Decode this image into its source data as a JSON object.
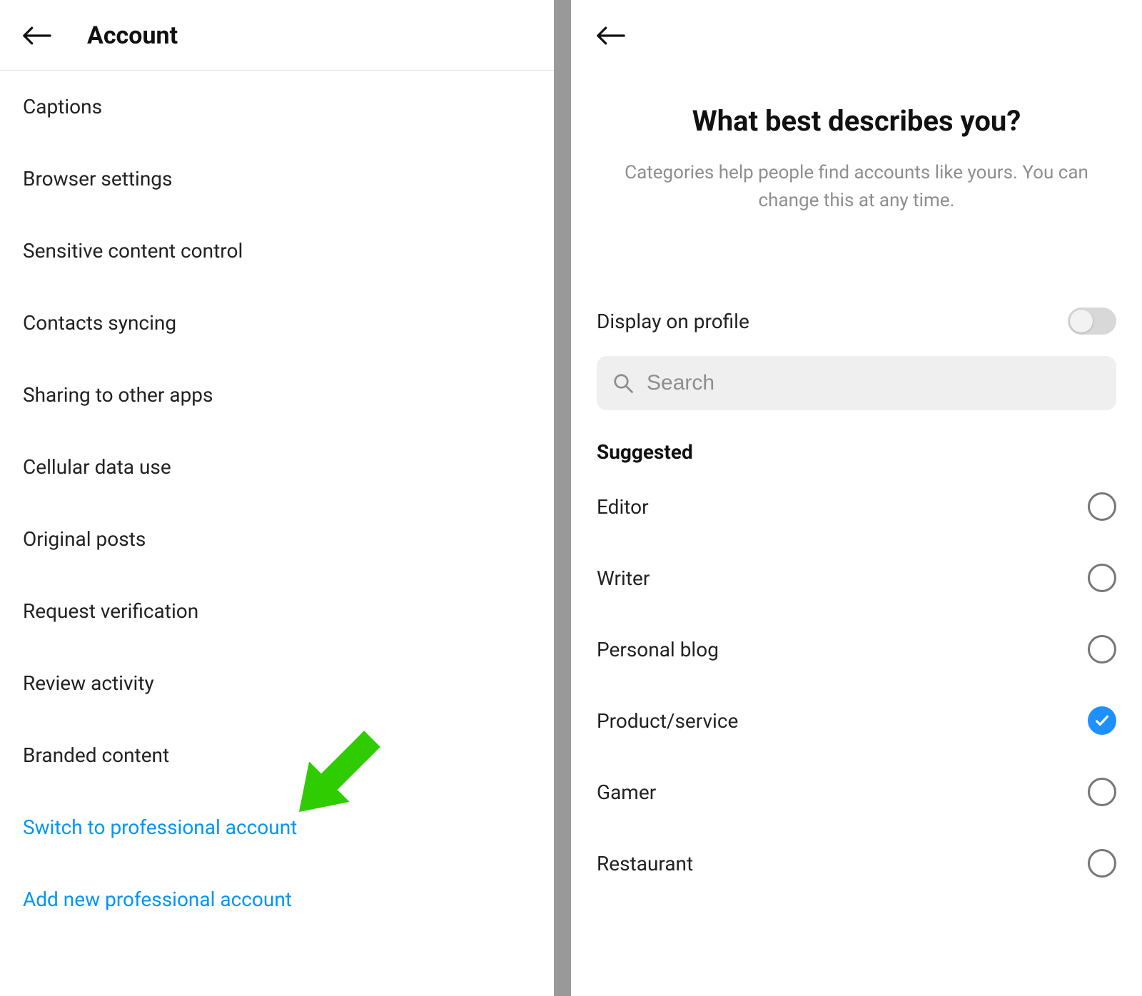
{
  "left": {
    "title": "Account",
    "items": [
      {
        "label": "Captions",
        "link": false
      },
      {
        "label": "Browser settings",
        "link": false
      },
      {
        "label": "Sensitive content control",
        "link": false
      },
      {
        "label": "Contacts syncing",
        "link": false
      },
      {
        "label": "Sharing to other apps",
        "link": false
      },
      {
        "label": "Cellular data use",
        "link": false
      },
      {
        "label": "Original posts",
        "link": false
      },
      {
        "label": "Request verification",
        "link": false
      },
      {
        "label": "Review activity",
        "link": false
      },
      {
        "label": "Branded content",
        "link": false
      },
      {
        "label": "Switch to professional account",
        "link": true
      },
      {
        "label": "Add new professional account",
        "link": true
      }
    ]
  },
  "right": {
    "hero_title": "What best describes you?",
    "hero_sub": "Categories help people find accounts like yours. You can change this at any time.",
    "display_label": "Display on profile",
    "display_on": false,
    "search_placeholder": "Search",
    "suggested_header": "Suggested",
    "categories": [
      {
        "label": "Editor",
        "selected": false
      },
      {
        "label": "Writer",
        "selected": false
      },
      {
        "label": "Personal blog",
        "selected": false
      },
      {
        "label": "Product/service",
        "selected": true
      },
      {
        "label": "Gamer",
        "selected": false
      },
      {
        "label": "Restaurant",
        "selected": false
      }
    ]
  },
  "colors": {
    "link": "#0095f6",
    "accent": "#1e90ff",
    "arrow": "#2ecc00"
  }
}
